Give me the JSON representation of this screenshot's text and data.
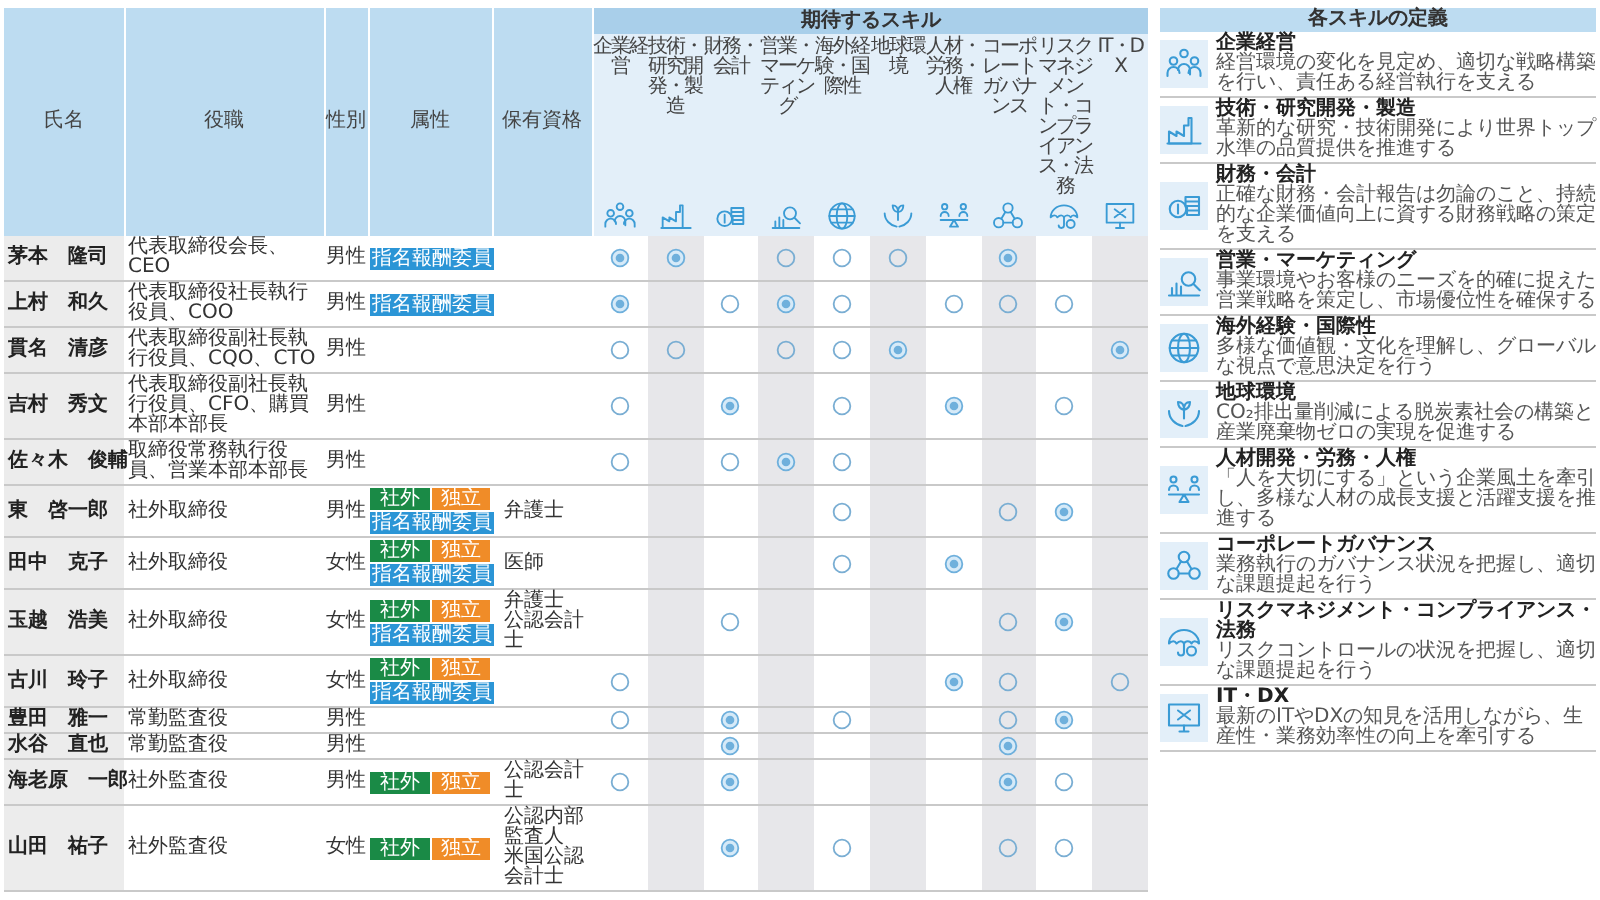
{
  "header": {
    "name": "氏名",
    "role": "役職",
    "gender": "性別",
    "attributes": "属性",
    "qualifications": "保有資格",
    "skills_title": "期待するスキル"
  },
  "skills": [
    {
      "label": "企業経営"
    },
    {
      "label": "技術・研究開発・製造"
    },
    {
      "label": "財務・会計"
    },
    {
      "label": "営業・マーケティング"
    },
    {
      "label": "海外経験・国際性"
    },
    {
      "label": "地球環境"
    },
    {
      "label": "人材・労務・人権"
    },
    {
      "label": "コーポレートガバナンス"
    },
    {
      "label": "リスクマネジメント・コンプライアンス・法務"
    },
    {
      "label": "IT・DX"
    }
  ],
  "members": [
    {
      "name": "茅本　隆司",
      "role": "代表取締役会長、CEO",
      "gender": "男性",
      "attributes": [
        {
          "label": "指名報酬委員",
          "color": "#2b95d6"
        }
      ],
      "skill_marks": [
        {
          "kind": "double"
        },
        {
          "kind": "double"
        },
        {
          "kind": "none"
        },
        {
          "kind": "single"
        },
        {
          "kind": "single"
        },
        {
          "kind": "single"
        },
        {
          "kind": "none"
        },
        {
          "kind": "double"
        },
        {
          "kind": "none"
        },
        {
          "kind": "none"
        }
      ]
    },
    {
      "name": "上村　和久",
      "role": "代表取締役社長執行役員、COO",
      "gender": "男性",
      "attributes": [
        {
          "label": "指名報酬委員",
          "color": "#2b95d6"
        }
      ],
      "skill_marks": [
        {
          "kind": "double"
        },
        {
          "kind": "none"
        },
        {
          "kind": "single"
        },
        {
          "kind": "double"
        },
        {
          "kind": "single"
        },
        {
          "kind": "none"
        },
        {
          "kind": "single"
        },
        {
          "kind": "single"
        },
        {
          "kind": "single"
        },
        {
          "kind": "none"
        }
      ]
    },
    {
      "name": "貫名　清彦",
      "role": "代表取締役副社長執行役員、CQO、CTO",
      "gender": "男性",
      "skill_marks": [
        {
          "kind": "single"
        },
        {
          "kind": "single"
        },
        {
          "kind": "none"
        },
        {
          "kind": "single"
        },
        {
          "kind": "single"
        },
        {
          "kind": "double"
        },
        {
          "kind": "none"
        },
        {
          "kind": "none"
        },
        {
          "kind": "none"
        },
        {
          "kind": "double"
        }
      ]
    },
    {
      "name": "吉村　秀文",
      "role": "代表取締役副社長執行役員、CFO、購買本部本部長",
      "gender": "男性",
      "skill_marks": [
        {
          "kind": "single"
        },
        {
          "kind": "none"
        },
        {
          "kind": "double"
        },
        {
          "kind": "none"
        },
        {
          "kind": "single"
        },
        {
          "kind": "none"
        },
        {
          "kind": "double"
        },
        {
          "kind": "none"
        },
        {
          "kind": "single"
        },
        {
          "kind": "none"
        }
      ]
    },
    {
      "name": "佐々木　俊輔",
      "role": "取締役常務執行役員、営業本部本部長",
      "gender": "男性",
      "skill_marks": [
        {
          "kind": "single"
        },
        {
          "kind": "none"
        },
        {
          "kind": "single"
        },
        {
          "kind": "double"
        },
        {
          "kind": "single"
        },
        {
          "kind": "none"
        },
        {
          "kind": "none"
        },
        {
          "kind": "none"
        },
        {
          "kind": "none"
        },
        {
          "kind": "none"
        }
      ]
    },
    {
      "name": "東　啓一郎",
      "role": "社外取締役",
      "gender": "男性",
      "attributes": [
        {
          "label": "社外",
          "color": "#1a8a46"
        },
        {
          "label": "独立",
          "color": "#f08c28"
        },
        {
          "label": "指名報酬委員",
          "color": "#2b95d6"
        }
      ],
      "qualifications": [
        "弁護士"
      ],
      "skill_marks": [
        {
          "kind": "none"
        },
        {
          "kind": "none"
        },
        {
          "kind": "none"
        },
        {
          "kind": "none"
        },
        {
          "kind": "single"
        },
        {
          "kind": "none"
        },
        {
          "kind": "none"
        },
        {
          "kind": "single"
        },
        {
          "kind": "double"
        },
        {
          "kind": "none"
        }
      ]
    },
    {
      "name": "田中　克子",
      "role": "社外取締役",
      "gender": "女性",
      "attributes": [
        {
          "label": "社外",
          "color": "#1a8a46"
        },
        {
          "label": "独立",
          "color": "#f08c28"
        },
        {
          "label": "指名報酬委員",
          "color": "#2b95d6"
        }
      ],
      "qualifications": [
        "医師"
      ],
      "skill_marks": [
        {
          "kind": "none"
        },
        {
          "kind": "none"
        },
        {
          "kind": "none"
        },
        {
          "kind": "none"
        },
        {
          "kind": "single"
        },
        {
          "kind": "none"
        },
        {
          "kind": "double"
        },
        {
          "kind": "none"
        },
        {
          "kind": "none"
        },
        {
          "kind": "none"
        }
      ]
    },
    {
      "name": "玉越　浩美",
      "role": "社外取締役",
      "gender": "女性",
      "attributes": [
        {
          "label": "社外",
          "color": "#1a8a46"
        },
        {
          "label": "独立",
          "color": "#f08c28"
        },
        {
          "label": "指名報酬委員",
          "color": "#2b95d6"
        }
      ],
      "qualifications": [
        "弁護士",
        "公認会計士"
      ],
      "skill_marks": [
        {
          "kind": "none"
        },
        {
          "kind": "none"
        },
        {
          "kind": "single"
        },
        {
          "kind": "none"
        },
        {
          "kind": "none"
        },
        {
          "kind": "none"
        },
        {
          "kind": "none"
        },
        {
          "kind": "single"
        },
        {
          "kind": "double"
        },
        {
          "kind": "none"
        }
      ]
    },
    {
      "name": "古川　玲子",
      "role": "社外取締役",
      "gender": "女性",
      "attributes": [
        {
          "label": "社外",
          "color": "#1a8a46"
        },
        {
          "label": "独立",
          "color": "#f08c28"
        },
        {
          "label": "指名報酬委員",
          "color": "#2b95d6"
        }
      ],
      "skill_marks": [
        {
          "kind": "single"
        },
        {
          "kind": "none"
        },
        {
          "kind": "none"
        },
        {
          "kind": "none"
        },
        {
          "kind": "none"
        },
        {
          "kind": "none"
        },
        {
          "kind": "double"
        },
        {
          "kind": "single"
        },
        {
          "kind": "none"
        },
        {
          "kind": "single"
        }
      ]
    },
    {
      "name": "豊田　雅一",
      "role": "常勤監査役",
      "gender": "男性",
      "skill_marks": [
        {
          "kind": "single"
        },
        {
          "kind": "none"
        },
        {
          "kind": "double"
        },
        {
          "kind": "none"
        },
        {
          "kind": "single"
        },
        {
          "kind": "none"
        },
        {
          "kind": "none"
        },
        {
          "kind": "single"
        },
        {
          "kind": "double"
        },
        {
          "kind": "none"
        }
      ]
    },
    {
      "name": "水谷　直也",
      "role": "常勤監査役",
      "gender": "男性",
      "skill_marks": [
        {
          "kind": "none"
        },
        {
          "kind": "none"
        },
        {
          "kind": "double"
        },
        {
          "kind": "none"
        },
        {
          "kind": "none"
        },
        {
          "kind": "none"
        },
        {
          "kind": "none"
        },
        {
          "kind": "double"
        },
        {
          "kind": "none"
        },
        {
          "kind": "none"
        }
      ]
    },
    {
      "name": "海老原　一郎",
      "role": "社外監査役",
      "gender": "男性",
      "attributes": [
        {
          "label": "社外",
          "color": "#1a8a46"
        },
        {
          "label": "独立",
          "color": "#f08c28"
        }
      ],
      "qualifications": [
        "公認会計士"
      ],
      "skill_marks": [
        {
          "kind": "single"
        },
        {
          "kind": "none"
        },
        {
          "kind": "double"
        },
        {
          "kind": "none"
        },
        {
          "kind": "none"
        },
        {
          "kind": "none"
        },
        {
          "kind": "none"
        },
        {
          "kind": "double"
        },
        {
          "kind": "single"
        },
        {
          "kind": "none"
        }
      ]
    },
    {
      "name": "山田　祐子",
      "role": "社外監査役",
      "gender": "女性",
      "attributes": [
        {
          "label": "社外",
          "color": "#1a8a46"
        },
        {
          "label": "独立",
          "color": "#f08c28"
        }
      ],
      "qualifications": [
        "公認内部監査人",
        "米国公認会計士"
      ],
      "skill_marks": [
        {
          "kind": "none"
        },
        {
          "kind": "none"
        },
        {
          "kind": "double"
        },
        {
          "kind": "none"
        },
        {
          "kind": "single"
        },
        {
          "kind": "none"
        },
        {
          "kind": "none"
        },
        {
          "kind": "single"
        },
        {
          "kind": "single"
        },
        {
          "kind": "none"
        }
      ]
    }
  ],
  "definitions": {
    "title": "各スキルの定義",
    "items": [
      {
        "title": "企業経営",
        "text": "経営環境の変化を見定め、適切な戦略構築を行い、責任ある経営執行を支える"
      },
      {
        "title": "技術・研究開発・製造",
        "text": "革新的な研究・技術開発により世界トップ水準の品質提供を推進する"
      },
      {
        "title": "財務・会計",
        "text": "正確な財務・会計報告は勿論のこと、持続的な企業価値向上に資する財務戦略の策定を支える"
      },
      {
        "title": "営業・マーケティング",
        "text": "事業環境やお客様のニーズを的確に捉えた営業戦略を策定し、市場優位性を確保する"
      },
      {
        "title": "海外経験・国際性",
        "text": "多様な価値観・文化を理解し、グローバルな視点で意思決定を行う"
      },
      {
        "title": "地球環境",
        "text": "CO₂排出量削減による脱炭素社会の構築と産業廃棄物ゼロの実現を促進する"
      },
      {
        "title": "人材開発・労務・人権",
        "text": "「人を大切にする」という企業風土を牽引し、多様な人材の成長支援と活躍支援を推進する"
      },
      {
        "title": "コーポレートガバナンス",
        "text": "業務執行のガバナンス状況を把握し、適切な課題提起を行う"
      },
      {
        "title": "リスクマネジメント・コンプライアンス・法務",
        "text": "リスクコントロールの状況を把握し、適切な課題提起を行う"
      },
      {
        "title": "IT・DX",
        "text": "最新のITやDXの知見を活用しながら、生産性・業務効率性の向上を牽引する"
      }
    ]
  }
}
